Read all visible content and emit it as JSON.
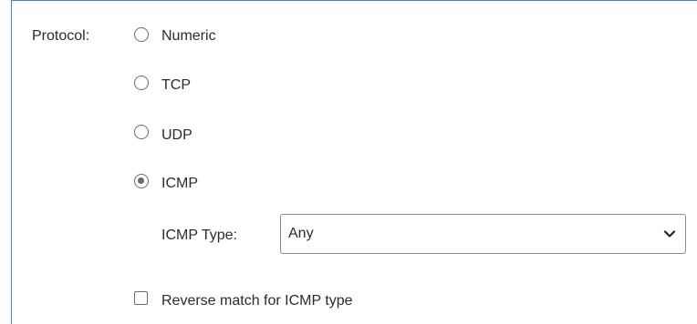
{
  "protocol": {
    "label": "Protocol:",
    "options": [
      {
        "label": "Numeric",
        "selected": false
      },
      {
        "label": "TCP",
        "selected": false
      },
      {
        "label": "UDP",
        "selected": false
      },
      {
        "label": "ICMP",
        "selected": true
      }
    ]
  },
  "icmp": {
    "type_label": "ICMP Type:",
    "type_value": "Any",
    "reverse_match_label": "Reverse match for ICMP type",
    "reverse_match_checked": false
  },
  "icons": {
    "dropdown": "chevron-down-icon"
  },
  "colors": {
    "frame_border": "#5b7fb0",
    "control_border": "#6b6b6b",
    "text": "#2b2b2b"
  }
}
